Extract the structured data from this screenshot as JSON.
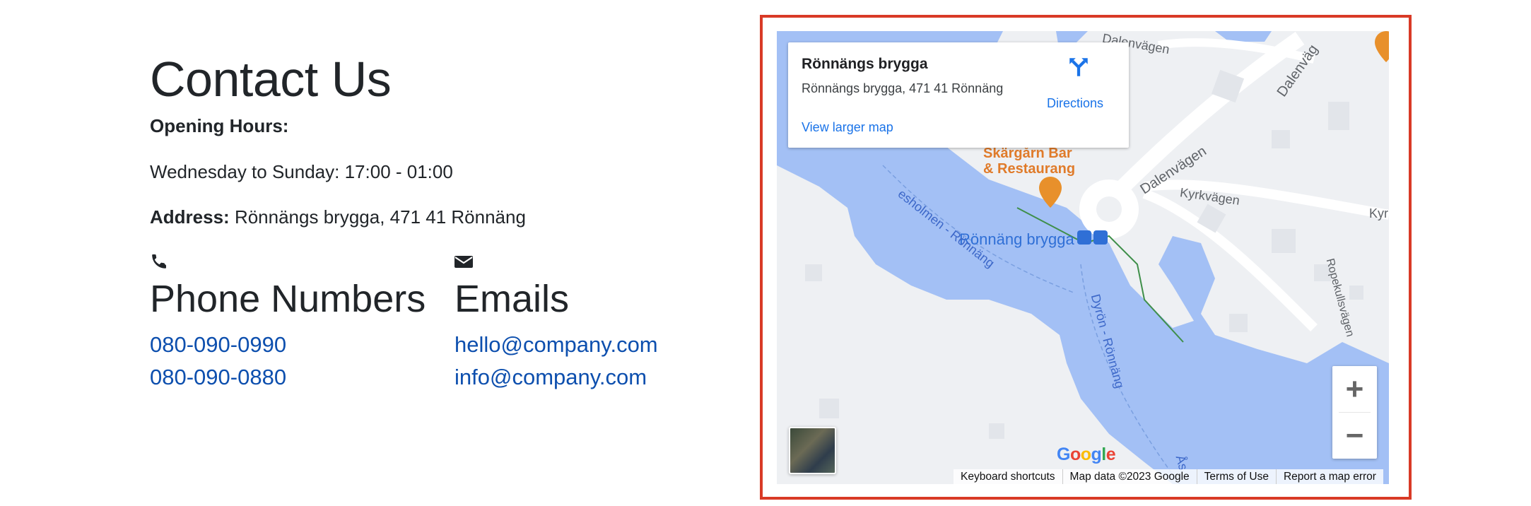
{
  "contact": {
    "title": "Contact Us",
    "opening_hours_label": "Opening Hours:",
    "opening_hours_value": "Wednesday to Sunday: 17:00 - 01:00",
    "address_label": "Address:",
    "address_value": "Rönnängs brygga, 471 41 Rönnäng"
  },
  "phones": {
    "icon": "phone-icon",
    "title": "Phone Numbers",
    "items": [
      "080-090-0990",
      "080-090-0880"
    ]
  },
  "emails": {
    "icon": "envelope-icon",
    "title": "Emails",
    "items": [
      "hello@company.com",
      "info@company.com"
    ]
  },
  "map": {
    "border_color": "#d93a26",
    "water_color": "#a3c0f5",
    "info_card": {
      "name": "Rönnängs brygga",
      "address": "Rönnängs brygga, 471 41 Rönnäng",
      "directions_label": "Directions",
      "view_larger_label": "View larger map"
    },
    "labels": {
      "restaurant_line1": "Skärgårn Bar",
      "restaurant_line2": "& Restaurang",
      "pier": "Rönnäng brygga",
      "dalenvagen": "Dalenvägen",
      "dalenvagen_top": "Dalenväg",
      "dalenvagen_topleft": "Dalenvägen",
      "kyrkvagen": "Kyrkvägen",
      "kyr_edge": "Kyr",
      "ropekullsvagen": "Ropekullsvägen",
      "ferry_route_1": "esholmen - Rönnäng",
      "ferry_route_2": "Dyrön - Rönnäng",
      "ferry_route_3": "Ås"
    },
    "google_logo": "Google",
    "footer": [
      "Keyboard shortcuts",
      "Map data ©2023 Google",
      "Terms of Use",
      "Report a map error"
    ]
  }
}
